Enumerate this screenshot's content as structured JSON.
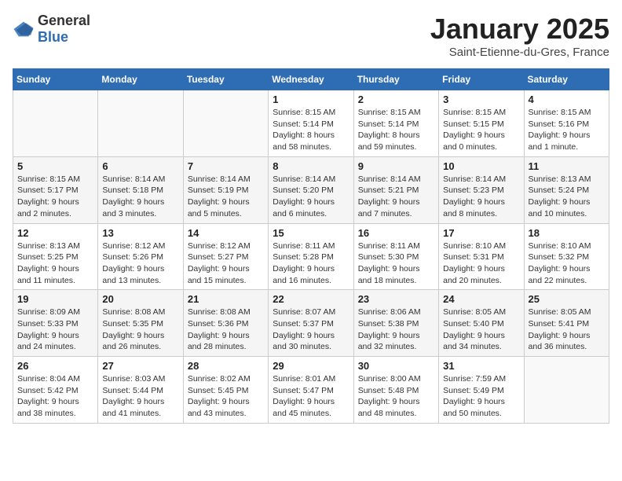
{
  "header": {
    "logo_general": "General",
    "logo_blue": "Blue",
    "month": "January 2025",
    "location": "Saint-Etienne-du-Gres, France"
  },
  "days_of_week": [
    "Sunday",
    "Monday",
    "Tuesday",
    "Wednesday",
    "Thursday",
    "Friday",
    "Saturday"
  ],
  "weeks": [
    [
      {
        "day": "",
        "sunrise": "",
        "sunset": "",
        "daylight": ""
      },
      {
        "day": "",
        "sunrise": "",
        "sunset": "",
        "daylight": ""
      },
      {
        "day": "",
        "sunrise": "",
        "sunset": "",
        "daylight": ""
      },
      {
        "day": "1",
        "sunrise": "Sunrise: 8:15 AM",
        "sunset": "Sunset: 5:14 PM",
        "daylight": "Daylight: 8 hours and 58 minutes."
      },
      {
        "day": "2",
        "sunrise": "Sunrise: 8:15 AM",
        "sunset": "Sunset: 5:14 PM",
        "daylight": "Daylight: 8 hours and 59 minutes."
      },
      {
        "day": "3",
        "sunrise": "Sunrise: 8:15 AM",
        "sunset": "Sunset: 5:15 PM",
        "daylight": "Daylight: 9 hours and 0 minutes."
      },
      {
        "day": "4",
        "sunrise": "Sunrise: 8:15 AM",
        "sunset": "Sunset: 5:16 PM",
        "daylight": "Daylight: 9 hours and 1 minute."
      }
    ],
    [
      {
        "day": "5",
        "sunrise": "Sunrise: 8:15 AM",
        "sunset": "Sunset: 5:17 PM",
        "daylight": "Daylight: 9 hours and 2 minutes."
      },
      {
        "day": "6",
        "sunrise": "Sunrise: 8:14 AM",
        "sunset": "Sunset: 5:18 PM",
        "daylight": "Daylight: 9 hours and 3 minutes."
      },
      {
        "day": "7",
        "sunrise": "Sunrise: 8:14 AM",
        "sunset": "Sunset: 5:19 PM",
        "daylight": "Daylight: 9 hours and 5 minutes."
      },
      {
        "day": "8",
        "sunrise": "Sunrise: 8:14 AM",
        "sunset": "Sunset: 5:20 PM",
        "daylight": "Daylight: 9 hours and 6 minutes."
      },
      {
        "day": "9",
        "sunrise": "Sunrise: 8:14 AM",
        "sunset": "Sunset: 5:21 PM",
        "daylight": "Daylight: 9 hours and 7 minutes."
      },
      {
        "day": "10",
        "sunrise": "Sunrise: 8:14 AM",
        "sunset": "Sunset: 5:23 PM",
        "daylight": "Daylight: 9 hours and 8 minutes."
      },
      {
        "day": "11",
        "sunrise": "Sunrise: 8:13 AM",
        "sunset": "Sunset: 5:24 PM",
        "daylight": "Daylight: 9 hours and 10 minutes."
      }
    ],
    [
      {
        "day": "12",
        "sunrise": "Sunrise: 8:13 AM",
        "sunset": "Sunset: 5:25 PM",
        "daylight": "Daylight: 9 hours and 11 minutes."
      },
      {
        "day": "13",
        "sunrise": "Sunrise: 8:12 AM",
        "sunset": "Sunset: 5:26 PM",
        "daylight": "Daylight: 9 hours and 13 minutes."
      },
      {
        "day": "14",
        "sunrise": "Sunrise: 8:12 AM",
        "sunset": "Sunset: 5:27 PM",
        "daylight": "Daylight: 9 hours and 15 minutes."
      },
      {
        "day": "15",
        "sunrise": "Sunrise: 8:11 AM",
        "sunset": "Sunset: 5:28 PM",
        "daylight": "Daylight: 9 hours and 16 minutes."
      },
      {
        "day": "16",
        "sunrise": "Sunrise: 8:11 AM",
        "sunset": "Sunset: 5:30 PM",
        "daylight": "Daylight: 9 hours and 18 minutes."
      },
      {
        "day": "17",
        "sunrise": "Sunrise: 8:10 AM",
        "sunset": "Sunset: 5:31 PM",
        "daylight": "Daylight: 9 hours and 20 minutes."
      },
      {
        "day": "18",
        "sunrise": "Sunrise: 8:10 AM",
        "sunset": "Sunset: 5:32 PM",
        "daylight": "Daylight: 9 hours and 22 minutes."
      }
    ],
    [
      {
        "day": "19",
        "sunrise": "Sunrise: 8:09 AM",
        "sunset": "Sunset: 5:33 PM",
        "daylight": "Daylight: 9 hours and 24 minutes."
      },
      {
        "day": "20",
        "sunrise": "Sunrise: 8:08 AM",
        "sunset": "Sunset: 5:35 PM",
        "daylight": "Daylight: 9 hours and 26 minutes."
      },
      {
        "day": "21",
        "sunrise": "Sunrise: 8:08 AM",
        "sunset": "Sunset: 5:36 PM",
        "daylight": "Daylight: 9 hours and 28 minutes."
      },
      {
        "day": "22",
        "sunrise": "Sunrise: 8:07 AM",
        "sunset": "Sunset: 5:37 PM",
        "daylight": "Daylight: 9 hours and 30 minutes."
      },
      {
        "day": "23",
        "sunrise": "Sunrise: 8:06 AM",
        "sunset": "Sunset: 5:38 PM",
        "daylight": "Daylight: 9 hours and 32 minutes."
      },
      {
        "day": "24",
        "sunrise": "Sunrise: 8:05 AM",
        "sunset": "Sunset: 5:40 PM",
        "daylight": "Daylight: 9 hours and 34 minutes."
      },
      {
        "day": "25",
        "sunrise": "Sunrise: 8:05 AM",
        "sunset": "Sunset: 5:41 PM",
        "daylight": "Daylight: 9 hours and 36 minutes."
      }
    ],
    [
      {
        "day": "26",
        "sunrise": "Sunrise: 8:04 AM",
        "sunset": "Sunset: 5:42 PM",
        "daylight": "Daylight: 9 hours and 38 minutes."
      },
      {
        "day": "27",
        "sunrise": "Sunrise: 8:03 AM",
        "sunset": "Sunset: 5:44 PM",
        "daylight": "Daylight: 9 hours and 41 minutes."
      },
      {
        "day": "28",
        "sunrise": "Sunrise: 8:02 AM",
        "sunset": "Sunset: 5:45 PM",
        "daylight": "Daylight: 9 hours and 43 minutes."
      },
      {
        "day": "29",
        "sunrise": "Sunrise: 8:01 AM",
        "sunset": "Sunset: 5:47 PM",
        "daylight": "Daylight: 9 hours and 45 minutes."
      },
      {
        "day": "30",
        "sunrise": "Sunrise: 8:00 AM",
        "sunset": "Sunset: 5:48 PM",
        "daylight": "Daylight: 9 hours and 48 minutes."
      },
      {
        "day": "31",
        "sunrise": "Sunrise: 7:59 AM",
        "sunset": "Sunset: 5:49 PM",
        "daylight": "Daylight: 9 hours and 50 minutes."
      },
      {
        "day": "",
        "sunrise": "",
        "sunset": "",
        "daylight": ""
      }
    ]
  ]
}
